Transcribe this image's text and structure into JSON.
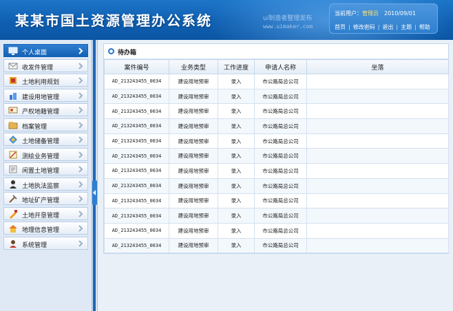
{
  "header": {
    "app_title": "某某市国土资源管理办公系统",
    "watermark_line1": "ui制造者整理发布",
    "watermark_line2": "www.uimaker.com",
    "user_label": "当前用户：",
    "user_name": "管理员",
    "date": "2010/09/01",
    "nav": [
      {
        "label": "首页"
      },
      {
        "label": "修改密码"
      },
      {
        "label": "退出"
      },
      {
        "label": "主题"
      },
      {
        "label": "帮助"
      }
    ],
    "nav_separator": "|"
  },
  "sidebar": {
    "items": [
      {
        "label": "个人桌面",
        "icon": "monitor-icon",
        "active": true
      },
      {
        "label": "收发件管理",
        "icon": "mail-icon",
        "active": false
      },
      {
        "label": "土地利用规划",
        "icon": "planning-icon",
        "active": false
      },
      {
        "label": "建设用地管理",
        "icon": "construction-icon",
        "active": false
      },
      {
        "label": "产权地籍管理",
        "icon": "id-card-icon",
        "active": false
      },
      {
        "label": "档案管理",
        "icon": "archive-icon",
        "active": false
      },
      {
        "label": "土地储备管理",
        "icon": "land-reserve-icon",
        "active": false
      },
      {
        "label": "测绘业务管理",
        "icon": "survey-icon",
        "active": false
      },
      {
        "label": "闲置土地管理",
        "icon": "idle-land-icon",
        "active": false
      },
      {
        "label": "土地执法监察",
        "icon": "inspector-icon",
        "active": false
      },
      {
        "label": "地址矿产管理",
        "icon": "mining-icon",
        "active": false
      },
      {
        "label": "土地开垦管理",
        "icon": "reclamation-icon",
        "active": false
      },
      {
        "label": "地理信息管理",
        "icon": "home-icon",
        "active": false
      },
      {
        "label": "系统管理",
        "icon": "admin-icon",
        "active": false
      }
    ],
    "arrow_icon": "chevron-right-icon",
    "colors": {
      "active_bg": "#1a6dc2",
      "item_border": "#b8cde6"
    }
  },
  "panel": {
    "title": "待办箱",
    "columns": [
      "案件编号",
      "业务类型",
      "工作进度",
      "申请人名称",
      "坐落"
    ],
    "rows": [
      [
        "AD_213243455_0034",
        "建设用地预审",
        "录入",
        "市公路局总公司",
        ""
      ],
      [
        "AD_213243455_0034",
        "建设用地预审",
        "录入",
        "市公路局总公司",
        ""
      ],
      [
        "AD_213243455_0034",
        "建设用地预审",
        "录入",
        "市公路局总公司",
        ""
      ],
      [
        "AD_213243455_0034",
        "建设用地预审",
        "录入",
        "市公路局总公司",
        ""
      ],
      [
        "AD_213243455_0034",
        "建设用地预审",
        "录入",
        "市公路局总公司",
        ""
      ],
      [
        "AD_213243455_0034",
        "建设用地预审",
        "录入",
        "市公路局总公司",
        ""
      ],
      [
        "AD_213243455_0034",
        "建设用地预审",
        "录入",
        "市公路局总公司",
        ""
      ],
      [
        "AD_213243455_0034",
        "建设用地预审",
        "录入",
        "市公路局总公司",
        ""
      ],
      [
        "AD_213243455_0034",
        "建设用地预审",
        "录入",
        "市公路局总公司",
        ""
      ],
      [
        "AD_213243455_0034",
        "建设用地预审",
        "录入",
        "市公路局总公司",
        ""
      ],
      [
        "AD_213243455_0034",
        "建设用地预审",
        "录入",
        "市公路局总公司",
        ""
      ],
      [
        "AD_213243455_0034",
        "建设用地预审",
        "录入",
        "市公路局总公司",
        ""
      ]
    ]
  },
  "colors": {
    "header_bg": "#0f5fb1",
    "accent": "#1f74c9",
    "user_name": "#ffe36b"
  }
}
